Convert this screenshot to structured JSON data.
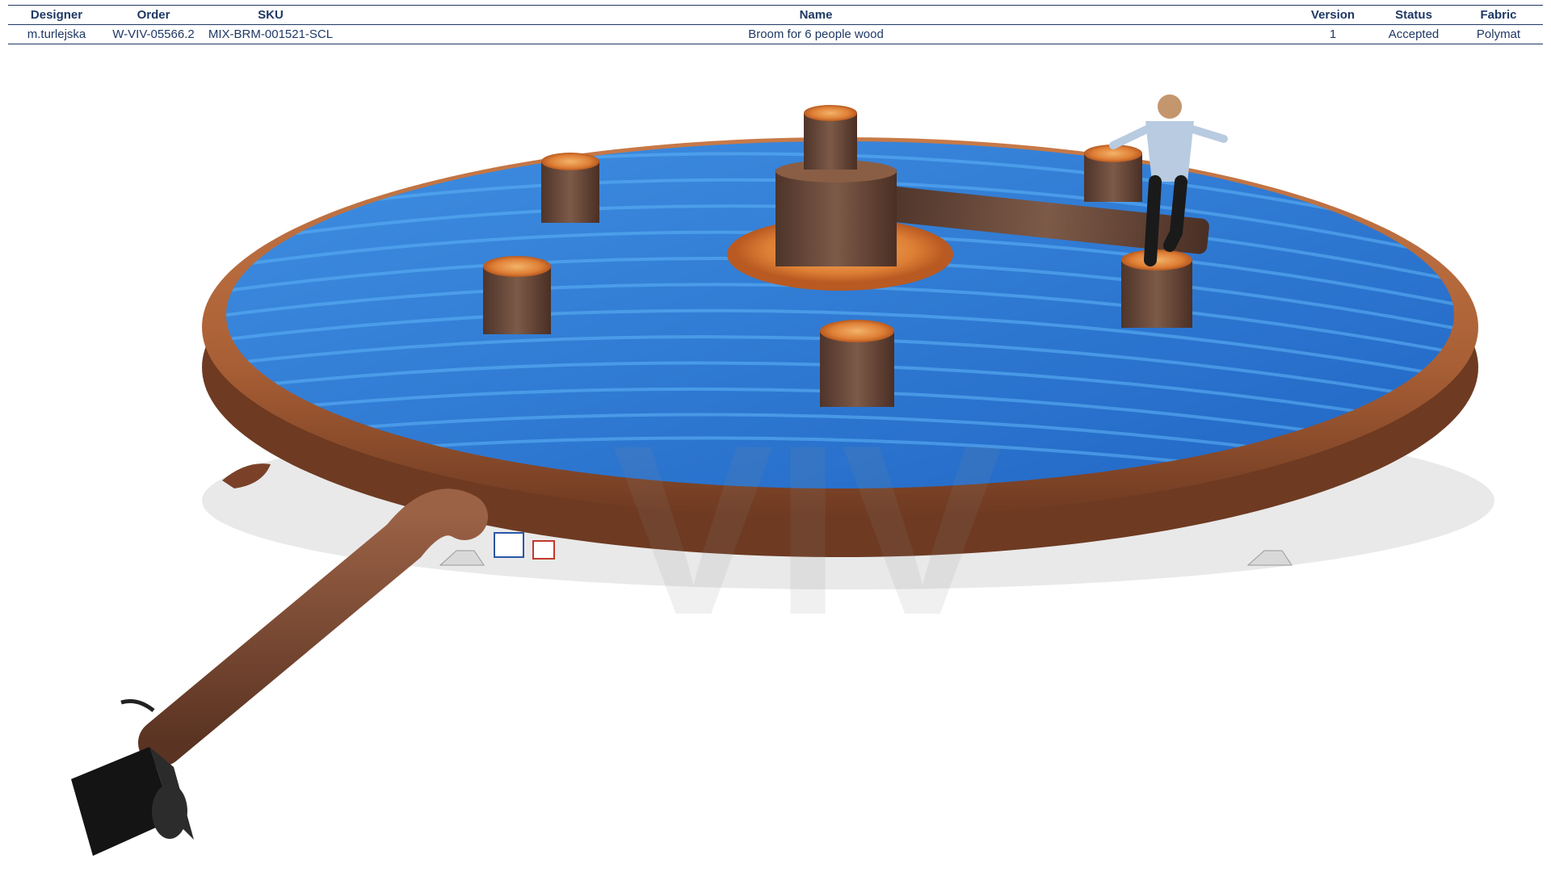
{
  "spec_table": {
    "headers": {
      "designer": "Designer",
      "order": "Order",
      "sku": "SKU",
      "name": "Name",
      "version": "Version",
      "status": "Status",
      "fabric": "Fabric"
    },
    "row": {
      "designer": "m.turlejska",
      "order": "W-VIV-05566.2",
      "sku": "MIX-BRM-001521-SCL",
      "name": "Broom for 6 people wood",
      "version": "1",
      "status": "Accepted",
      "fabric": "Polymat"
    }
  },
  "product_render": {
    "watermark": "VIV",
    "colors": {
      "rim": "#b8683a",
      "rim_dark": "#7a4128",
      "mat": "#2f7fd8",
      "mat_light": "#5aa6ef",
      "bark": "#6b4a3a",
      "wood_face": "#e08a3c",
      "blower": "#1a1a1a"
    }
  }
}
